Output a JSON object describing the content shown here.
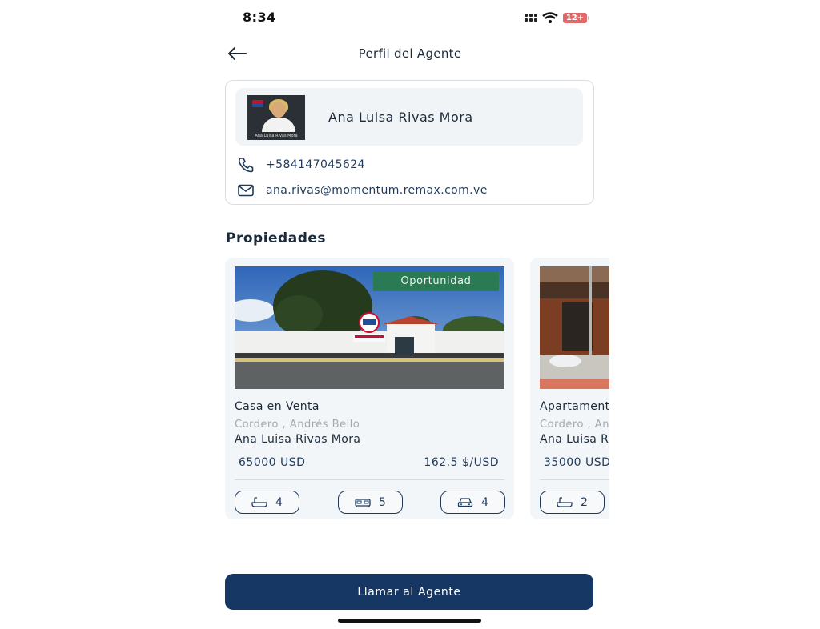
{
  "status_bar": {
    "time": "8:34",
    "battery": "12+"
  },
  "header": {
    "title": "Perfil del Agente"
  },
  "agent": {
    "name": "Ana Luisa Rivas Mora",
    "phone": "+584147045624",
    "email": "ana.rivas@momentum.remax.com.ve"
  },
  "properties_section": {
    "title": "Propiedades"
  },
  "properties": [
    {
      "badge": "Oportunidad",
      "title": "Casa en Venta",
      "location": "Cordero , Andrés Bello",
      "agent": "Ana Luisa Rivas Mora",
      "price": "65000 USD",
      "price_per_m2": "162.5 $/USD",
      "bathrooms": "4",
      "bedrooms": "5",
      "parking": "4"
    },
    {
      "title": "Apartamento",
      "location": "Cordero , Andrés Bello",
      "agent": "Ana Luisa Rivas Mora",
      "price": "35000 USD",
      "bathrooms": "2"
    }
  ],
  "footer": {
    "call_button": "Llamar al Agente"
  },
  "colors": {
    "primary": "#163764",
    "badge": "#2a7a54",
    "text": "#1b2a3a",
    "muted": "#a4a9ae"
  }
}
